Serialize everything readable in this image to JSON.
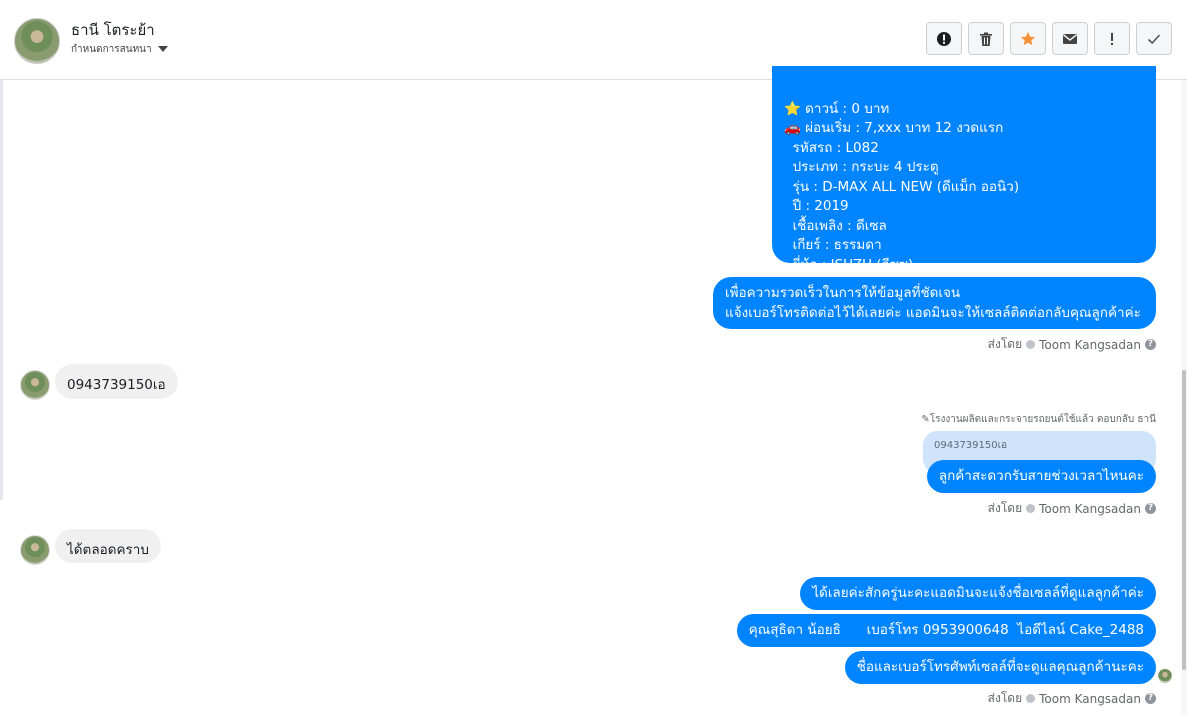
{
  "header": {
    "contact_name": "ธานี โตระย้า",
    "contact_sub": "กำหนดการสนทนา",
    "buttons": [
      "alert-icon",
      "trash-icon",
      "star-icon",
      "mail-icon",
      "exclamation-icon",
      "check-icon"
    ],
    "star_color": "#f7923a"
  },
  "messages": {
    "card_lines": [
      "⭐ ดาวน์ : 0 บาท",
      "🚗 ผ่อนเริ่ม : 7,xxx บาท 12 งวดแรก",
      "  รหัสรถ : L082",
      "  ประเภท : กระบะ 4 ประตู",
      "  รุ่น : D-MAX ALL NEW (ดีแม็ก ออนิว)",
      "  ปี : 2019",
      "  เชื้อเพลิง : ดีเซล",
      "  เกียร์ : ธรรมดา",
      "  ยี่ห้อ : ISUZU (อีซูซุ)"
    ],
    "info_msg": "เพื่อความรวดเร็วในการให้ข้อมูลที่ชัดเจน\nแจ้งเบอร์โทรติดต่อไว้ได้เลยค่ะ แอดมินจะให้เซลล์ติดต่อกลับคุณลูกค้าค่ะ",
    "sent_by_label": "ส่งโดย",
    "sent_by_name": "Toom Kangsadan",
    "customer_msg_1": "0943739150เอ",
    "reply_note": "✎โรงงานผลิตและกระจายรถยนต์ใช้แล้ว ตอบกลับ ธานี",
    "quoted_text": "0943739150เอ",
    "reply_msg": "ลูกค้าสะดวกรับสายช่วงเวลาไหนคะ",
    "customer_msg_2": "ได้ตลอดคราบ",
    "final_msg_1": "ได้เลยค่ะสักครู่นะคะแอดมินจะแจ้งชื่อเซลล์ที่ดูแลลูกค้าค่ะ",
    "final_msg_2": "คุณสุธิดา น้อยธิ      เบอร์โทร 0953900648  ไอดีไลน์ Cake_2488",
    "final_msg_3": "ชื่อและเบอร์โทรศัพท์เซลล์ที่จะดูแลคุณลูกค้านะคะ",
    "accent_color": "#0084ff"
  }
}
